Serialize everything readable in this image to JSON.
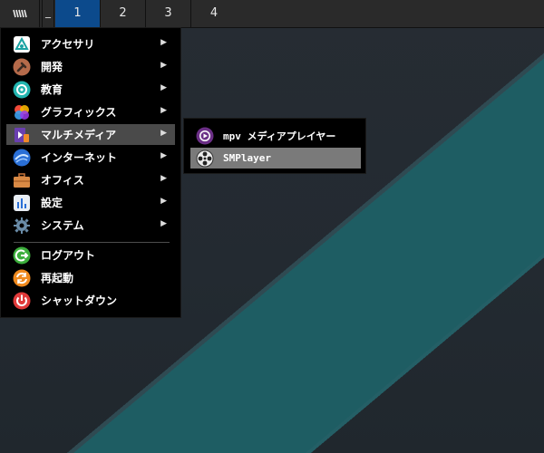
{
  "panel": {
    "minimize_label": "_",
    "workspaces": [
      "1",
      "2",
      "3",
      "4"
    ],
    "active_workspace": "1",
    "active_color": "#0c4a8c"
  },
  "menu": {
    "items": [
      {
        "label": "アクセサリ",
        "icon": "accessories-icon",
        "has_submenu": true
      },
      {
        "label": "開発",
        "icon": "development-hammer-icon",
        "has_submenu": true
      },
      {
        "label": "教育",
        "icon": "education-icon",
        "has_submenu": true
      },
      {
        "label": "グラフィックス",
        "icon": "graphics-icon",
        "has_submenu": true
      },
      {
        "label": "マルチメディア",
        "icon": "multimedia-icon",
        "has_submenu": true,
        "highlighted": true
      },
      {
        "label": "インターネット",
        "icon": "internet-globe-icon",
        "has_submenu": true
      },
      {
        "label": "オフィス",
        "icon": "office-briefcase-icon",
        "has_submenu": true
      },
      {
        "label": "設定",
        "icon": "settings-icon",
        "has_submenu": true
      },
      {
        "label": "システム",
        "icon": "system-gear-icon",
        "has_submenu": true
      },
      {
        "label": "ログアウト",
        "icon": "logout-icon",
        "has_submenu": false
      },
      {
        "label": "再起動",
        "icon": "reboot-icon",
        "has_submenu": false
      },
      {
        "label": "シャットダウン",
        "icon": "shutdown-power-icon",
        "has_submenu": false
      }
    ],
    "arrow": "▶",
    "highlight_color": "#4a4a4a"
  },
  "submenu": {
    "items": [
      {
        "label": "mpv メディアプレイヤー",
        "icon": "mpv-icon"
      },
      {
        "label": "SMPlayer",
        "icon": "smplayer-icon",
        "highlighted": true
      }
    ],
    "highlight_color": "#7a7a7a"
  },
  "desktop": {
    "background_color": "#232a31",
    "stripe_color": "#1e5d63"
  }
}
